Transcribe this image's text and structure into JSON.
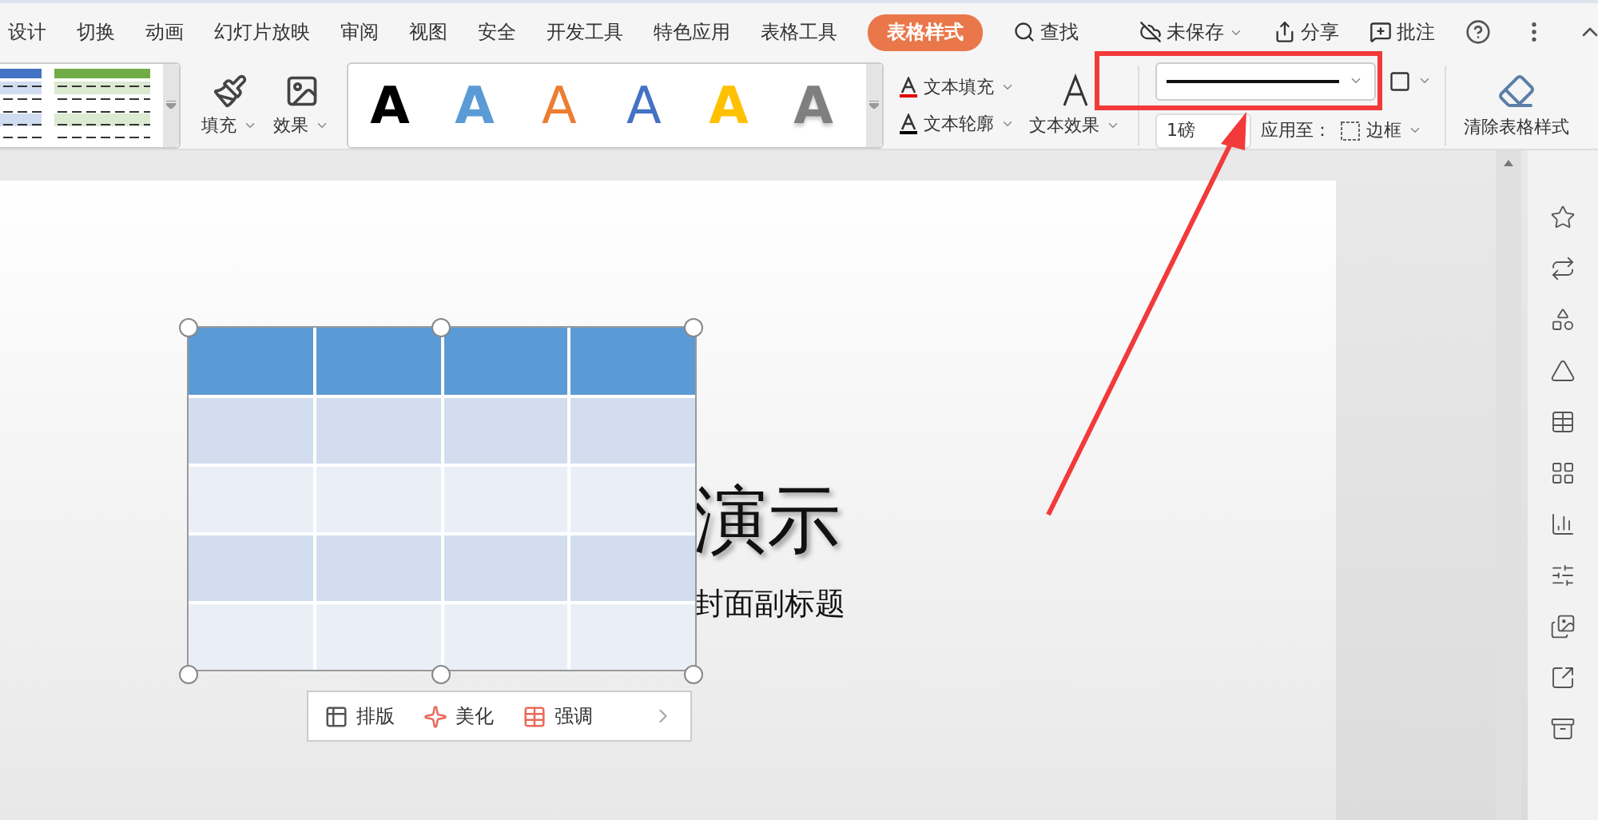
{
  "tabs": [
    {
      "label": "设计",
      "selected": false
    },
    {
      "label": "切换",
      "selected": false
    },
    {
      "label": "动画",
      "selected": false
    },
    {
      "label": "幻灯片放映",
      "selected": false
    },
    {
      "label": "审阅",
      "selected": false
    },
    {
      "label": "视图",
      "selected": false
    },
    {
      "label": "安全",
      "selected": false
    },
    {
      "label": "开发工具",
      "selected": false
    },
    {
      "label": "特色应用",
      "selected": false
    },
    {
      "label": "表格工具",
      "selected": false
    },
    {
      "label": "表格样式",
      "selected": true
    }
  ],
  "search": {
    "label": "查找"
  },
  "top_actions": [
    {
      "kind": "cloud",
      "label": "未保存",
      "dropdown": true
    },
    {
      "kind": "share",
      "label": "分享",
      "dropdown": false
    },
    {
      "kind": "comment",
      "label": "批注",
      "dropdown": false
    }
  ],
  "ribbon": {
    "fill_label": "填充",
    "effect_label": "效果",
    "text_fill": "文本填充",
    "text_outline": "文本轮廓",
    "text_effect": "文本效果",
    "line_weight": "1磅",
    "apply_to_label": "应用至：",
    "apply_target": "边框",
    "clear_label": "清除表格样式"
  },
  "table_styles": [
    {
      "color": "#4472c4"
    },
    {
      "color": "#70ad47"
    }
  ],
  "wordart_styles": [
    {
      "letter": "A",
      "kind": "solid",
      "color": "#000000"
    },
    {
      "letter": "A",
      "kind": "solid",
      "color": "#5b9bd5"
    },
    {
      "letter": "A",
      "kind": "outline",
      "color": "#ed7d31"
    },
    {
      "letter": "A",
      "kind": "outline",
      "color": "#4472c4"
    },
    {
      "letter": "A",
      "kind": "solid",
      "color": "#ffc000"
    },
    {
      "letter": "A",
      "kind": "gradient",
      "color": "#7f7f7f"
    }
  ],
  "slide": {
    "title": "演示",
    "subtitle": "封面副标题",
    "table_rows": [
      {
        "kind": "header"
      },
      {
        "kind": "band"
      },
      {
        "kind": "plain"
      },
      {
        "kind": "band"
      },
      {
        "kind": "plain"
      }
    ]
  },
  "float_toolbar": [
    {
      "kind": "layout",
      "label": "排版"
    },
    {
      "kind": "beautify",
      "label": "美化"
    },
    {
      "kind": "emphasis",
      "label": "强调"
    }
  ]
}
